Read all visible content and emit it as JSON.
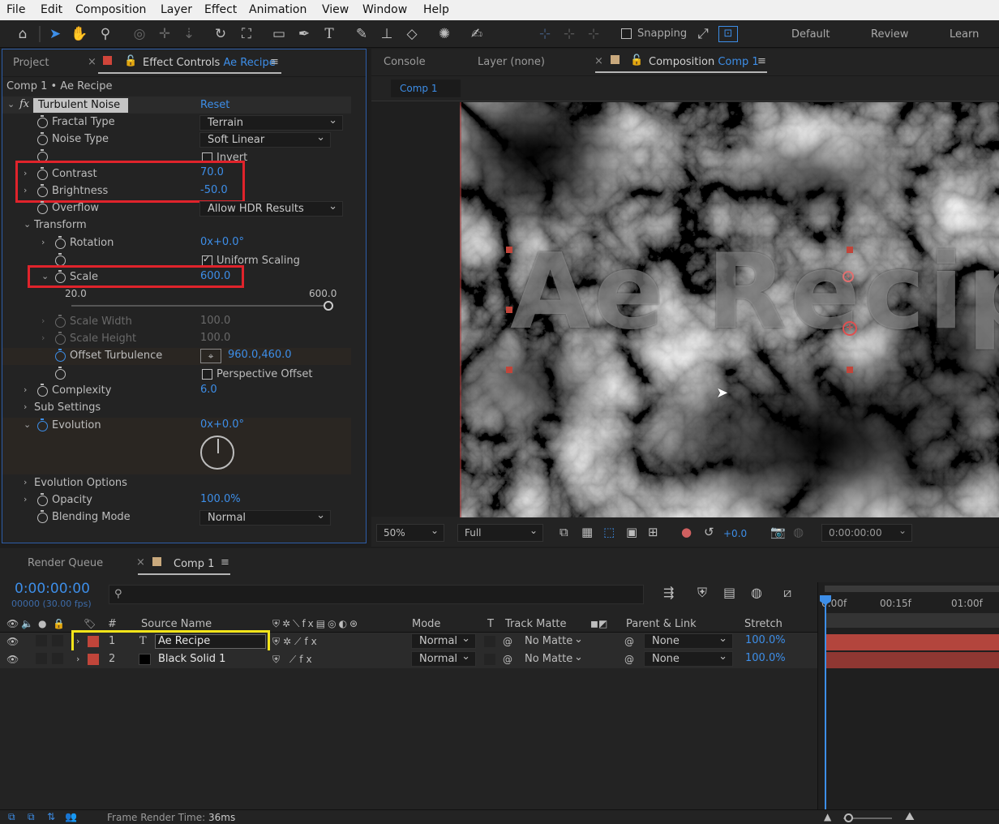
{
  "menu": [
    "File",
    "Edit",
    "Composition",
    "Layer",
    "Effect",
    "Animation",
    "View",
    "Window",
    "Help"
  ],
  "toolbar": {
    "snapping_label": "Snapping",
    "workspaces": [
      "Default",
      "Review",
      "Learn"
    ]
  },
  "left_panel": {
    "tabs": {
      "project": "Project",
      "effect_controls_prefix": "Effect Controls",
      "effect_controls_layer": "Ae Recipe"
    },
    "breadcrumb": "Comp 1 • Ae Recipe",
    "effect": {
      "fx": "fx",
      "name": "Turbulent Noise",
      "reset": "Reset"
    },
    "props": {
      "fractal_type": {
        "label": "Fractal Type",
        "value": "Terrain"
      },
      "noise_type": {
        "label": "Noise Type",
        "value": "Soft Linear"
      },
      "invert": {
        "label": "Invert"
      },
      "contrast": {
        "label": "Contrast",
        "value": "70.0"
      },
      "brightness": {
        "label": "Brightness",
        "value": "-50.0"
      },
      "overflow": {
        "label": "Overflow",
        "value": "Allow HDR Results"
      },
      "transform": {
        "label": "Transform"
      },
      "rotation": {
        "label": "Rotation",
        "value": "0x+0.0°"
      },
      "uniform_scaling": {
        "label": "Uniform Scaling"
      },
      "scale": {
        "label": "Scale",
        "value": "600.0",
        "min": "20.0",
        "max": "600.0"
      },
      "scale_width": {
        "label": "Scale Width",
        "value": "100.0"
      },
      "scale_height": {
        "label": "Scale Height",
        "value": "100.0"
      },
      "offset_turbulence": {
        "label": "Offset Turbulence",
        "value": "960.0,460.0"
      },
      "perspective_offset": {
        "label": "Perspective Offset"
      },
      "complexity": {
        "label": "Complexity",
        "value": "6.0"
      },
      "sub_settings": {
        "label": "Sub Settings"
      },
      "evolution": {
        "label": "Evolution",
        "value": "0x+0.0°"
      },
      "evolution_options": {
        "label": "Evolution Options"
      },
      "opacity": {
        "label": "Opacity",
        "value": "100.0%"
      },
      "blending_mode": {
        "label": "Blending Mode",
        "value": "Normal"
      }
    }
  },
  "right_panel": {
    "tabs": {
      "console": "Console",
      "layer": "Layer (none)",
      "composition_prefix": "Composition",
      "composition_name": "Comp 1"
    },
    "comp_tab": "Comp 1",
    "viewer_text": "Ae Recipe",
    "viewbar": {
      "zoom": "50%",
      "resolution": "Full",
      "exposure": "+0.0",
      "timecode": "0:00:00:00"
    }
  },
  "timeline": {
    "tabs": {
      "render_queue": "Render Queue",
      "comp": "Comp 1"
    },
    "timecode": "0:00:00:00",
    "frames": "00000 (30.00 fps)",
    "search_placeholder": "",
    "columns": {
      "num": "#",
      "source_name": "Source Name",
      "mode": "Mode",
      "t": "T",
      "track_matte": "Track Matte",
      "parent": "Parent & Link",
      "stretch": "Stretch"
    },
    "ruler": [
      "0:00f",
      "00:15f",
      "01:00f"
    ],
    "layers": [
      {
        "num": "1",
        "type": "T",
        "name": "Ae Recipe",
        "mode": "Normal",
        "matte": "No Matte",
        "parent": "None",
        "stretch": "100.0%",
        "color": "#c0453a"
      },
      {
        "num": "2",
        "type": "",
        "name": "Black Solid 1",
        "mode": "Normal",
        "matte": "No Matte",
        "parent": "None",
        "stretch": "100.0%",
        "color": "#c0453a"
      }
    ]
  },
  "status": {
    "label": "Frame Render Time:",
    "value": "36ms"
  }
}
